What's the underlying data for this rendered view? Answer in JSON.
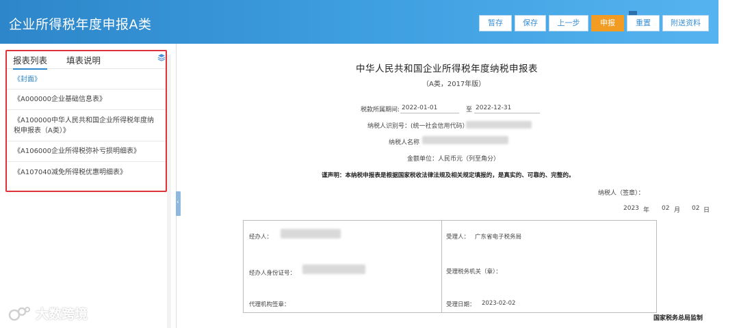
{
  "header": {
    "title": "企业所得税年度申报A类",
    "buttons": {
      "save_draft": "暂存",
      "save": "保存",
      "prev": "上一步",
      "submit": "申报",
      "reset": "重置",
      "attach": "附送资料"
    }
  },
  "sidebar": {
    "tabs": [
      "报表列表",
      "填表说明"
    ],
    "items": [
      "《封面》",
      "《A000000企业基础信息表》",
      "《A100000中华人民共和国企业所得税年度纳税申报表（A类）》",
      "《A106000企业所得税弥补亏损明细表》",
      "《A107040减免所得税优惠明细表》"
    ]
  },
  "watermark": {
    "text": "大数跨境"
  },
  "form": {
    "title": "中华人民共和国企业所得税年度纳税申报表",
    "subtitle": "（A类，2017年版）",
    "period_label": "税款所属期间:",
    "period_start": "2022-01-01",
    "period_to": "至",
    "period_end": "2022-12-31",
    "taxpayer_id_label": "纳税人识别号：(统一社会信用代码）",
    "taxpayer_name_label": "纳税人名称",
    "amount_unit": "金额单位：人民币元（列至角分）",
    "statement": "谨声明：本纳税申报表是根据国家税收法律法规及相关规定填报的，是真实的、可靠的、完整的。",
    "taxpayer_sign_label": "纳税人（签章）：",
    "date_year": "2023",
    "date_year_unit": "年",
    "date_month": "02",
    "date_month_unit": "月",
    "date_day": "02",
    "date_day_unit": "日",
    "handler_label": "经办人：",
    "handler_id_label": "经办人身份证号：",
    "agency_sign_label": "代理机构签章：",
    "receiver_label": "受理人：",
    "receiver_value": "广东省电子税务局",
    "tax_office_label": "受理税务机关（章）：",
    "accept_date_label": "受理日期：",
    "accept_date_value": "2023-02-02",
    "supervision": "国家税务总局监制"
  }
}
